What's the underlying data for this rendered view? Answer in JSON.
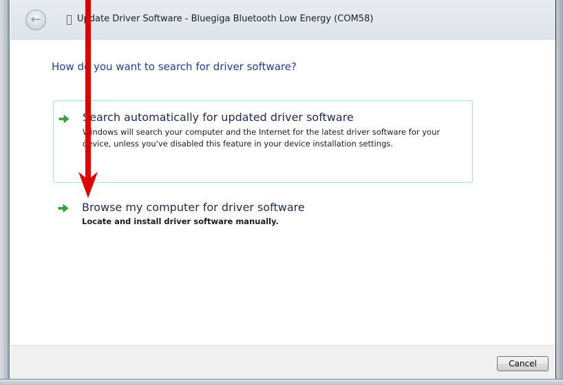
{
  "window": {
    "title": "Update Driver Software - Bluegiga Bluetooth Low Energy (COM58)"
  },
  "nav": {
    "back_icon": "back-arrow-icon",
    "back_glyph": "←"
  },
  "main": {
    "heading": "How do you want to search for driver software?",
    "options": [
      {
        "title": "Search automatically for updated driver software",
        "description": "Windows will search your computer and the Internet for the latest driver software for your device, unless you've disabled this feature in your device installation settings.",
        "icon": "green-arrow-icon"
      },
      {
        "title": "Browse my computer for driver software",
        "description": "Locate and install driver software manually.",
        "icon": "green-arrow-icon"
      }
    ]
  },
  "footer": {
    "cancel_label": "Cancel"
  },
  "colors": {
    "heading": "#1d3f95",
    "hover_border": "#a9dff2",
    "annotation": "#e00000",
    "arrow_green": "#2ea73a"
  }
}
